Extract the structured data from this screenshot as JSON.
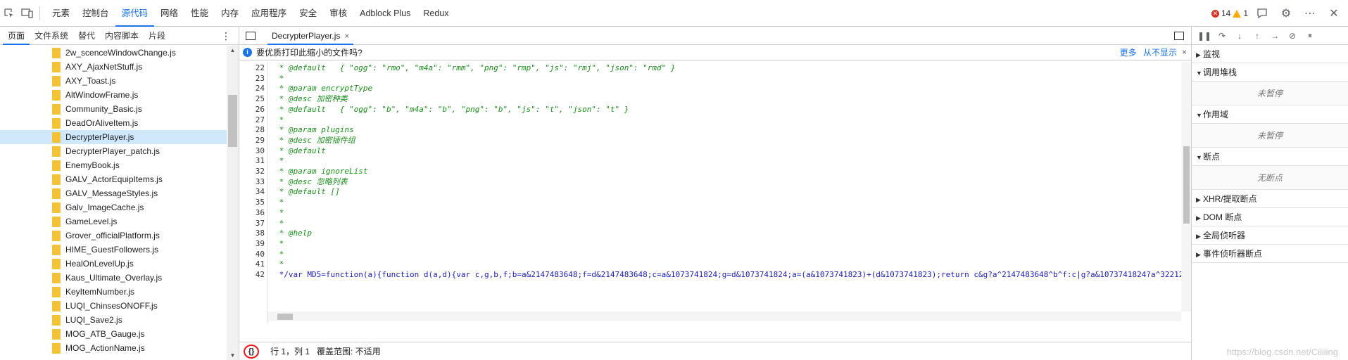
{
  "toolbar": {
    "tabs": [
      "元素",
      "控制台",
      "源代码",
      "网络",
      "性能",
      "内存",
      "应用程序",
      "安全",
      "审核",
      "Adblock Plus",
      "Redux"
    ],
    "active_tab": "源代码",
    "errors": "14",
    "warnings": "1"
  },
  "left": {
    "subtabs": [
      "页面",
      "文件系统",
      "替代",
      "内容脚本",
      "片段"
    ],
    "more": "⋮",
    "files": [
      "2w_scenceWindowChange.js",
      "AXY_AjaxNetStuff.js",
      "AXY_Toast.js",
      "AltWindowFrame.js",
      "Community_Basic.js",
      "DeadOrAliveItem.js",
      "DecrypterPlayer.js",
      "DecrypterPlayer_patch.js",
      "EnemyBook.js",
      "GALV_ActorEquipItems.js",
      "GALV_MessageStyles.js",
      "Galv_ImageCache.js",
      "GameLevel.js",
      "Grover_officialPlatform.js",
      "HIME_GuestFollowers.js",
      "HealOnLevelUp.js",
      "Kaus_Ultimate_Overlay.js",
      "KeyItemNumber.js",
      "LUQI_ChinsesONOFF.js",
      "LUQI_Save2.js",
      "MOG_ATB_Gauge.js",
      "MOG_ActionName.js"
    ],
    "selected_file": "DecrypterPlayer.js"
  },
  "editor": {
    "tab_name": "DecrypterPlayer.js",
    "tab_close": "×",
    "infobar": {
      "message": "要优质打印此缩小的文件吗?",
      "more": "更多",
      "never": "从不显示",
      "close": "×"
    },
    "code_lines": [
      {
        "n": "22",
        "t": " * @default   { \"ogg\": \"rmo\", \"m4a\": \"rmm\", \"png\": \"rmp\", \"js\": \"rmj\", \"json\": \"rmd\" }",
        "c": "cm"
      },
      {
        "n": "23",
        "t": " *",
        "c": "cm"
      },
      {
        "n": "24",
        "t": " * @param encryptType",
        "c": "cm"
      },
      {
        "n": "25",
        "t": " * @desc 加密种类",
        "c": "cm"
      },
      {
        "n": "26",
        "t": " * @default   { \"ogg\": \"b\", \"m4a\": \"b\", \"png\": \"b\", \"js\": \"t\", \"json\": \"t\" }",
        "c": "cm"
      },
      {
        "n": "27",
        "t": " *",
        "c": "cm"
      },
      {
        "n": "28",
        "t": " * @param plugins",
        "c": "cm"
      },
      {
        "n": "29",
        "t": " * @desc 加密插件组",
        "c": "cm"
      },
      {
        "n": "30",
        "t": " * @default",
        "c": "cm"
      },
      {
        "n": "31",
        "t": " *",
        "c": "cm"
      },
      {
        "n": "32",
        "t": " * @param ignoreList",
        "c": "cm"
      },
      {
        "n": "33",
        "t": " * @desc 忽略列表",
        "c": "cm"
      },
      {
        "n": "34",
        "t": " * @default []",
        "c": "cm"
      },
      {
        "n": "35",
        "t": " *",
        "c": "cm"
      },
      {
        "n": "36",
        "t": " *",
        "c": "cm"
      },
      {
        "n": "37",
        "t": " *",
        "c": "cm"
      },
      {
        "n": "38",
        "t": " * @help",
        "c": "cm"
      },
      {
        "n": "39",
        "t": " *",
        "c": "cm"
      },
      {
        "n": "40",
        "t": " *",
        "c": "cm"
      },
      {
        "n": "41",
        "t": " *",
        "c": "cm"
      },
      {
        "n": "42",
        "t": " */var MD5=function(a){function d(a,d){var c,g,b,f;b=a&2147483648;f=d&2147483648;c=a&1073741824;g=d&1073741824;a=(a&1073741823)+(d&1073741823);return c&g?a^2147483648^b^f:c|g?a&1073741824?a^322122",
        "c": "code"
      }
    ],
    "status": {
      "pretty": "{}",
      "position": "行 1，列 1",
      "coverage": "覆盖范围: 不适用"
    }
  },
  "debugger": {
    "sections": [
      {
        "title": "监视",
        "expanded": false,
        "body": ""
      },
      {
        "title": "调用堆栈",
        "expanded": true,
        "body": "未暂停"
      },
      {
        "title": "作用域",
        "expanded": true,
        "body": "未暂停"
      },
      {
        "title": "断点",
        "expanded": true,
        "body": "无断点"
      },
      {
        "title": "XHR/提取断点",
        "expanded": false,
        "body": ""
      },
      {
        "title": "DOM 断点",
        "expanded": false,
        "body": ""
      },
      {
        "title": "全局侦听器",
        "expanded": false,
        "body": ""
      },
      {
        "title": "事件侦听器断点",
        "expanded": false,
        "body": ""
      }
    ]
  },
  "watermark": "https://blog.csdn.net/Ciiiiing"
}
